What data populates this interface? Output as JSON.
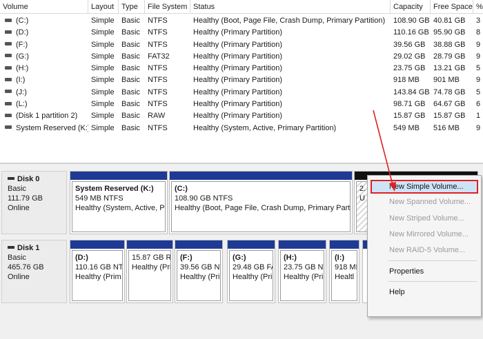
{
  "columns": {
    "volume": "Volume",
    "layout": "Layout",
    "type": "Type",
    "file_system": "File System",
    "status": "Status",
    "capacity": "Capacity",
    "free_space": "Free Space",
    "pct": "%"
  },
  "volumes": [
    {
      "name": "(C:)",
      "layout": "Simple",
      "type": "Basic",
      "fs": "NTFS",
      "status": "Healthy (Boot, Page File, Crash Dump, Primary Partition)",
      "capacity": "108.90 GB",
      "free": "40.81 GB",
      "pct": "3"
    },
    {
      "name": "(D:)",
      "layout": "Simple",
      "type": "Basic",
      "fs": "NTFS",
      "status": "Healthy (Primary Partition)",
      "capacity": "110.16 GB",
      "free": "95.90 GB",
      "pct": "8"
    },
    {
      "name": "(F:)",
      "layout": "Simple",
      "type": "Basic",
      "fs": "NTFS",
      "status": "Healthy (Primary Partition)",
      "capacity": "39.56 GB",
      "free": "38.88 GB",
      "pct": "9"
    },
    {
      "name": "(G:)",
      "layout": "Simple",
      "type": "Basic",
      "fs": "FAT32",
      "status": "Healthy (Primary Partition)",
      "capacity": "29.02 GB",
      "free": "28.79 GB",
      "pct": "9"
    },
    {
      "name": "(H:)",
      "layout": "Simple",
      "type": "Basic",
      "fs": "NTFS",
      "status": "Healthy (Primary Partition)",
      "capacity": "23.75 GB",
      "free": "13.21 GB",
      "pct": "5"
    },
    {
      "name": "(I:)",
      "layout": "Simple",
      "type": "Basic",
      "fs": "NTFS",
      "status": "Healthy (Primary Partition)",
      "capacity": "918 MB",
      "free": "901 MB",
      "pct": "9"
    },
    {
      "name": "(J:)",
      "layout": "Simple",
      "type": "Basic",
      "fs": "NTFS",
      "status": "Healthy (Primary Partition)",
      "capacity": "143.84 GB",
      "free": "74.78 GB",
      "pct": "5"
    },
    {
      "name": "(L:)",
      "layout": "Simple",
      "type": "Basic",
      "fs": "NTFS",
      "status": "Healthy (Primary Partition)",
      "capacity": "98.71 GB",
      "free": "64.67 GB",
      "pct": "6"
    },
    {
      "name": "(Disk 1 partition 2)",
      "layout": "Simple",
      "type": "Basic",
      "fs": "RAW",
      "status": "Healthy (Primary Partition)",
      "capacity": "15.87 GB",
      "free": "15.87 GB",
      "pct": "1"
    },
    {
      "name": "System Reserved (K:)",
      "layout": "Simple",
      "type": "Basic",
      "fs": "NTFS",
      "status": "Healthy (System, Active, Primary Partition)",
      "capacity": "549 MB",
      "free": "516 MB",
      "pct": "9"
    }
  ],
  "disk0": {
    "name": "Disk 0",
    "type": "Basic",
    "size": "111.79 GB",
    "state": "Online",
    "partitions": [
      {
        "name": "System Reserved  (K:)",
        "size": "549 MB NTFS",
        "status": "Healthy (System, Active, P"
      },
      {
        "name": "(C:)",
        "size": "108.90 GB NTFS",
        "status": "Healthy (Boot, Page File, Crash Dump, Primary Part"
      },
      {
        "name": "",
        "size": "2.",
        "status": "U"
      }
    ]
  },
  "disk1": {
    "name": "Disk 1",
    "type": "Basic",
    "size": "465.76 GB",
    "state": "Online",
    "partitions": [
      {
        "name": "(D:)",
        "size": "110.16 GB NTI",
        "status": "Healthy (Prim"
      },
      {
        "name": "",
        "size": "15.87 GB R/",
        "status": "Healthy (Pri"
      },
      {
        "name": "(F:)",
        "size": "39.56 GB NT",
        "status": "Healthy (Pri"
      },
      {
        "name": "(G:)",
        "size": "29.48 GB FA",
        "status": "Healthy (Pri"
      },
      {
        "name": "(H:)",
        "size": "23.75 GB NT",
        "status": "Healthy (Pri"
      },
      {
        "name": "(I:)",
        "size": "918 MB",
        "status": "Healtl"
      }
    ]
  },
  "context_menu": {
    "items": [
      {
        "label": "New Simple Volume...",
        "enabled": true,
        "highlighted": true
      },
      {
        "label": "New Spanned Volume...",
        "enabled": false
      },
      {
        "label": "New Striped Volume...",
        "enabled": false
      },
      {
        "label": "New Mirrored Volume...",
        "enabled": false
      },
      {
        "label": "New RAID-5 Volume...",
        "enabled": false
      },
      {
        "label": "Properties",
        "enabled": true
      },
      {
        "label": "Help",
        "enabled": true
      }
    ]
  },
  "colors": {
    "partition_bar": "#1f3a94",
    "unallocated_bar": "#111111",
    "highlight_border": "#e01f1f",
    "arrow": "#e01f1f"
  }
}
